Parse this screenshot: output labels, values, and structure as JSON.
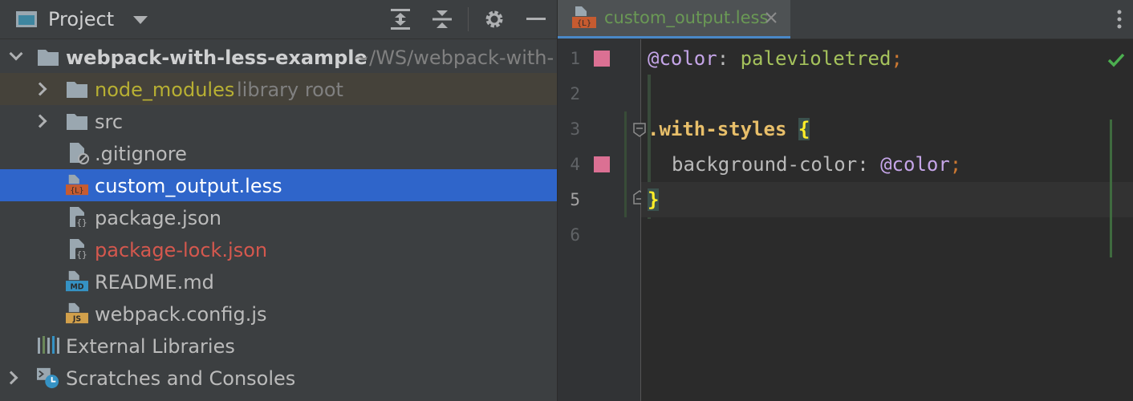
{
  "project_panel": {
    "title": "Project",
    "tools": [
      "expand-all-icon",
      "collapse-all-icon",
      "gear-icon",
      "hide-icon"
    ]
  },
  "tree": {
    "root": {
      "name": "webpack-with-less-example",
      "path": "~/WS/webpack-with-"
    },
    "node_modules": {
      "name": "node_modules",
      "hint": "library root"
    },
    "src": "src",
    "gitignore": ".gitignore",
    "custom_output": "custom_output.less",
    "package_json": "package.json",
    "package_lock": "package-lock.json",
    "readme": "README.md",
    "webpack_config": "webpack.config.js",
    "external_libraries": "External Libraries",
    "scratches": "Scratches and Consoles"
  },
  "editor": {
    "tab_label": "custom_output.less",
    "line_numbers": [
      "1",
      "2",
      "3",
      "4",
      "5",
      "6"
    ],
    "current_line": 5,
    "swatch_color": "#db7093",
    "code": {
      "l1_var": "@color",
      "l1_colon": ": ",
      "l1_value": "palevioletred",
      "l1_semi": ";",
      "l3_selector": ".with-styles",
      "l3_brace": "{",
      "l4_prop": "background-color",
      "l4_colon": ": ",
      "l4_var": "@color",
      "l4_semi": ";",
      "l5_brace": "}"
    }
  },
  "colors": {
    "selection": "#2f65ca",
    "library_row": "#45423a",
    "less_icon": "#c65b30",
    "modified_file": "#d5584e",
    "library_root": "#b8b033"
  }
}
